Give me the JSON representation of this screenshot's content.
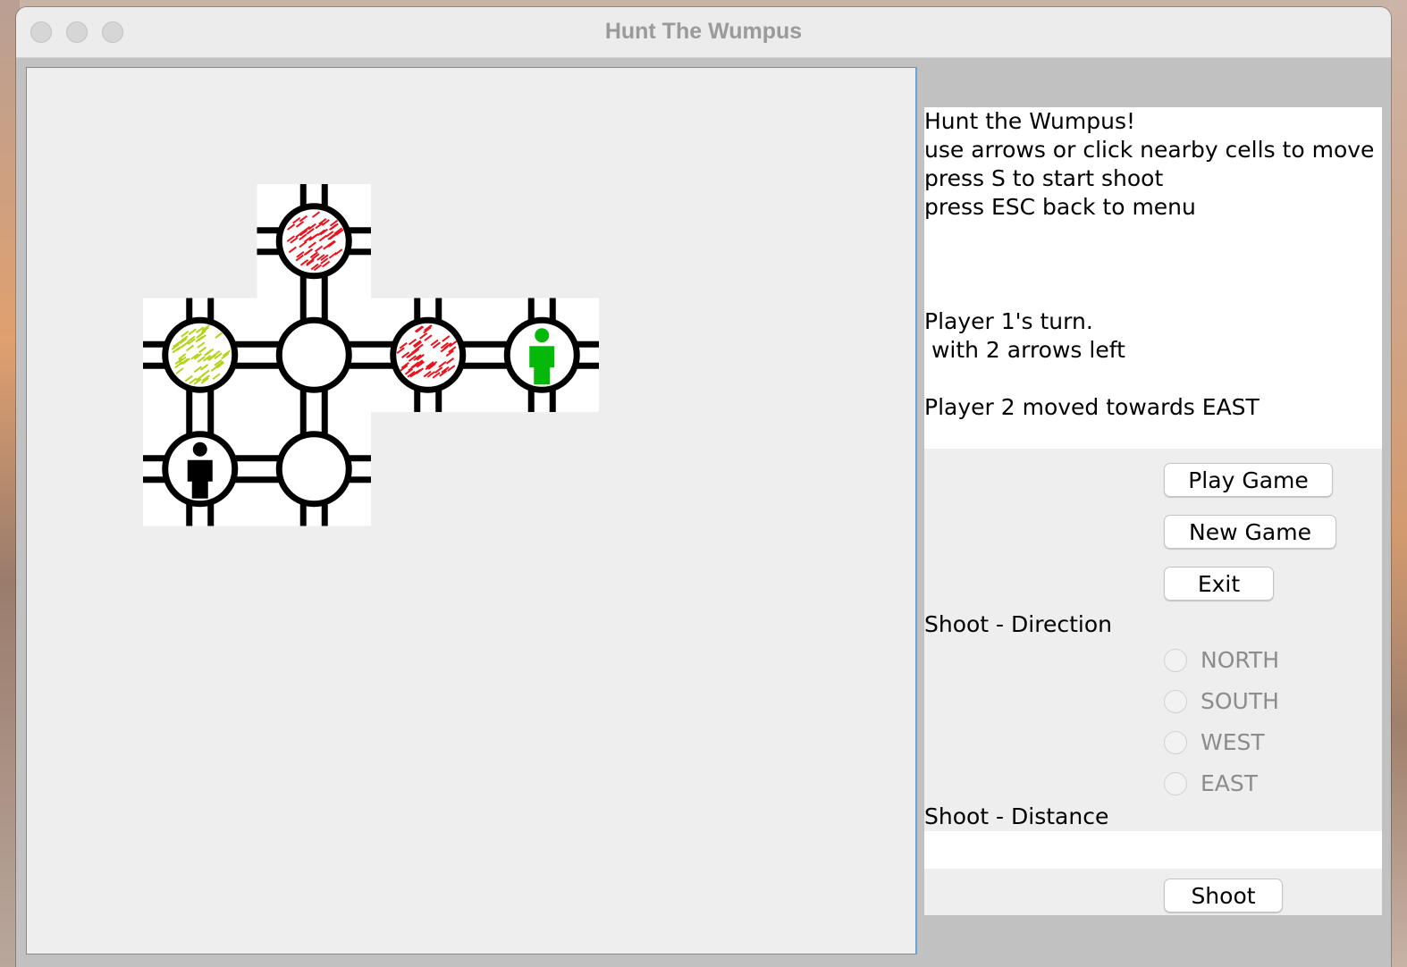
{
  "window": {
    "title": "Hunt The Wumpus"
  },
  "info": {
    "lines": [
      "Hunt the Wumpus!",
      "use arrows or click nearby cells to move",
      "press S to start shoot",
      "press ESC back to menu",
      "",
      "",
      "",
      "Player 1's turn.",
      " with 2 arrows left",
      "",
      "Player 2 moved towards EAST"
    ]
  },
  "buttons": {
    "play": "Play Game",
    "new": "New Game",
    "exit": "Exit",
    "shoot": "Shoot"
  },
  "shoot": {
    "direction_label": "Shoot - Direction",
    "directions": [
      "NORTH",
      "SOUTH",
      "WEST",
      "EAST"
    ],
    "distance_label": "Shoot - Distance",
    "distance_value": ""
  },
  "board": {
    "cells": [
      {
        "row": 0,
        "col": 1,
        "content": "red-hazard"
      },
      {
        "row": 1,
        "col": 0,
        "content": "green-hazard"
      },
      {
        "row": 1,
        "col": 1,
        "content": "empty"
      },
      {
        "row": 1,
        "col": 2,
        "content": "red-hazard"
      },
      {
        "row": 1,
        "col": 3,
        "content": "player-green"
      },
      {
        "row": 2,
        "col": 0,
        "content": "player-black"
      },
      {
        "row": 2,
        "col": 1,
        "content": "empty"
      }
    ]
  },
  "colors": {
    "red_hazard": "#e8141e",
    "green_hazard": "#b5d21a",
    "player1": "#06b80a",
    "player2": "#000000"
  }
}
